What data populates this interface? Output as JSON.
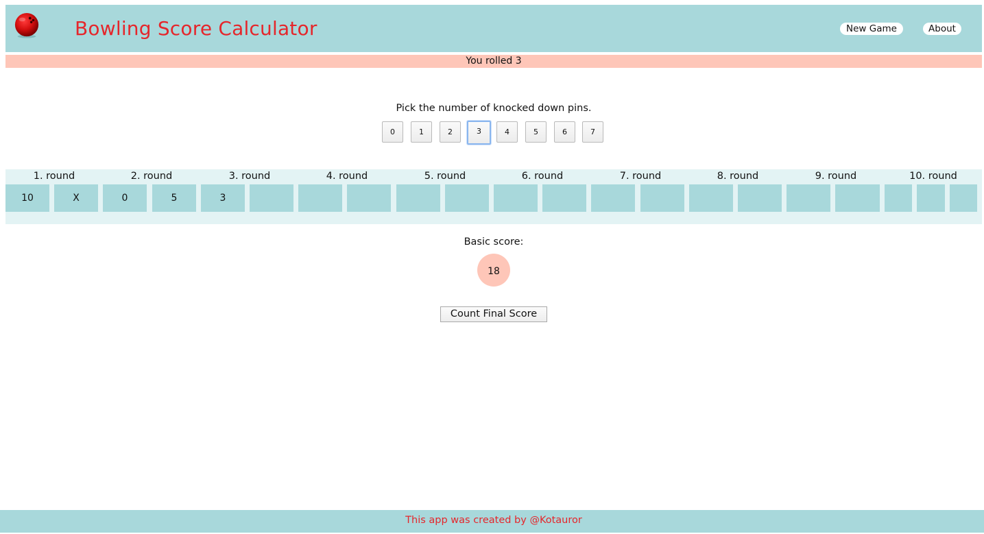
{
  "header": {
    "title": "Bowling Score Calculator",
    "logo_icon": "bowling-ball-icon",
    "nav": {
      "new_game": "New Game",
      "about": "About"
    }
  },
  "status": {
    "message": "You rolled 3"
  },
  "pin_picker": {
    "label": "Pick the number of knocked down pins.",
    "options": [
      "0",
      "1",
      "2",
      "3",
      "4",
      "5",
      "6",
      "7"
    ],
    "selected": "3"
  },
  "rounds": {
    "labels": [
      "1. round",
      "2. round",
      "3. round",
      "4. round",
      "5. round",
      "6. round",
      "7. round",
      "8. round",
      "9. round",
      "10. round"
    ],
    "rolls": [
      "10",
      "X",
      "0",
      "5",
      "3",
      "",
      "",
      "",
      "",
      "",
      "",
      "",
      "",
      "",
      "",
      "",
      "",
      "",
      "",
      "",
      ""
    ]
  },
  "score": {
    "label": "Basic score:",
    "value": "18"
  },
  "actions": {
    "count_final": "Count Final Score"
  },
  "footer": {
    "text": "This app was created by @Kotauror"
  },
  "colors": {
    "header_bg": "#a8d8db",
    "accent_red": "#e5262b",
    "status_bg": "#fec6b8",
    "rounds_bg": "#e3f3f4"
  }
}
